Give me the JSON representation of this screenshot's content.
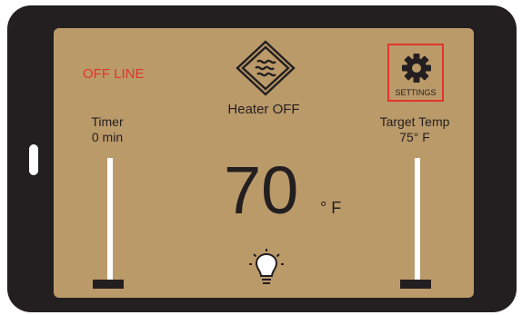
{
  "status": {
    "text": "OFF LINE",
    "color": "#e0352b"
  },
  "heater": {
    "state": "Heater OFF",
    "logo_icon": "heater-logo-icon"
  },
  "settings": {
    "label": "SETTINGS",
    "icon": "gear-icon"
  },
  "timer": {
    "title": "Timer",
    "value": "0 min",
    "level": 0
  },
  "target": {
    "title": "Target Temp",
    "value": "75° F",
    "level": 0
  },
  "current_temp": {
    "value": "70",
    "unit": "° F"
  },
  "light": {
    "icon": "light-bulb-icon"
  },
  "colors": {
    "screen": "#bb9a6a",
    "bezel": "#231f20",
    "accent": "#e0352b"
  }
}
